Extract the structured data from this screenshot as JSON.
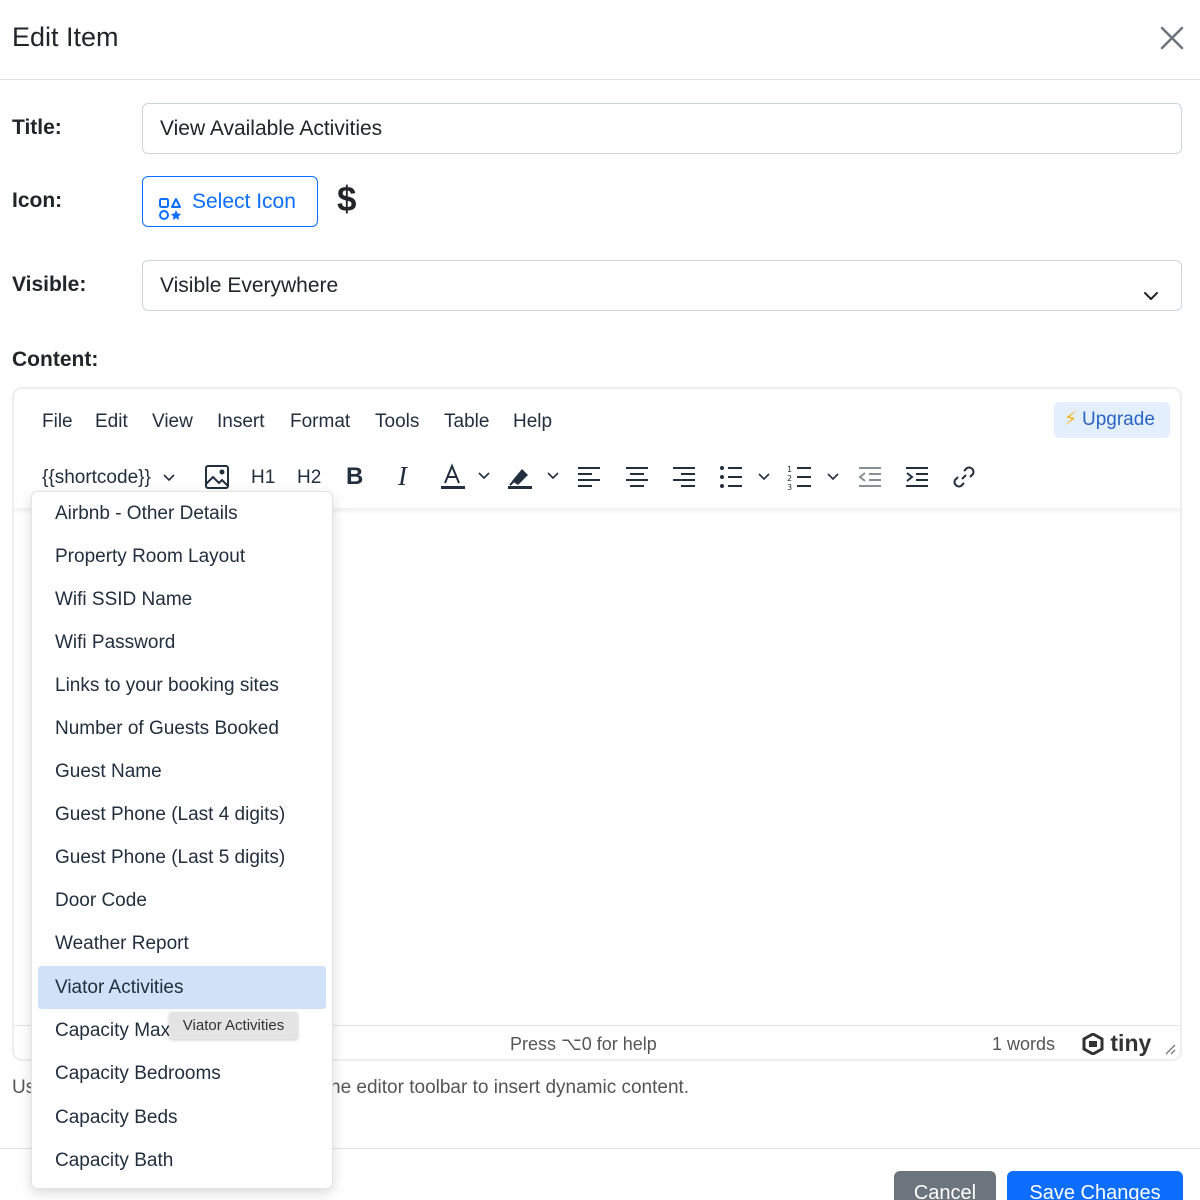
{
  "modal": {
    "title": "Edit Item"
  },
  "form": {
    "title_label": "Title:",
    "title_value": "View Available Activities",
    "icon_label": "Icon:",
    "select_icon_label": "Select Icon",
    "selected_icon_glyph": "$",
    "visible_label": "Visible:",
    "visible_value": "Visible Everywhere",
    "content_label": "Content:"
  },
  "editor": {
    "menubar": [
      "File",
      "Edit",
      "View",
      "Insert",
      "Format",
      "Tools",
      "Table",
      "Help"
    ],
    "upgrade_label": "Upgrade",
    "toolbar": {
      "shortcode_label": "{{shortcode}}",
      "h1": "H1",
      "h2": "H2"
    },
    "status": {
      "help": "Press ⌥0 for help",
      "words": "1 words",
      "brand": "tiny"
    },
    "helper_prefix": "Us",
    "helper_suffix": "he editor toolbar to insert dynamic content."
  },
  "dropdown": {
    "items": [
      "Airbnb - Other Details",
      "Property Room Layout",
      "Wifi SSID Name",
      "Wifi Password",
      "Links to your booking sites",
      "Number of Guests Booked",
      "Guest Name",
      "Guest Phone (Last 4 digits)",
      "Guest Phone (Last 5 digits)",
      "Door Code",
      "Weather Report",
      "Viator Activities",
      "Capacity Max",
      "Capacity Bedrooms",
      "Capacity Beds",
      "Capacity Bath"
    ],
    "active_item": "Viator Activities",
    "tooltip": "Viator Activities"
  },
  "footer": {
    "cancel_label": "Cancel",
    "save_label": "Save Changes"
  },
  "colors": {
    "primary": "#0d6efd",
    "secondary": "#6c757d",
    "active_item_bg": "#cfe2f7",
    "upgrade_bg": "#e3effd"
  }
}
